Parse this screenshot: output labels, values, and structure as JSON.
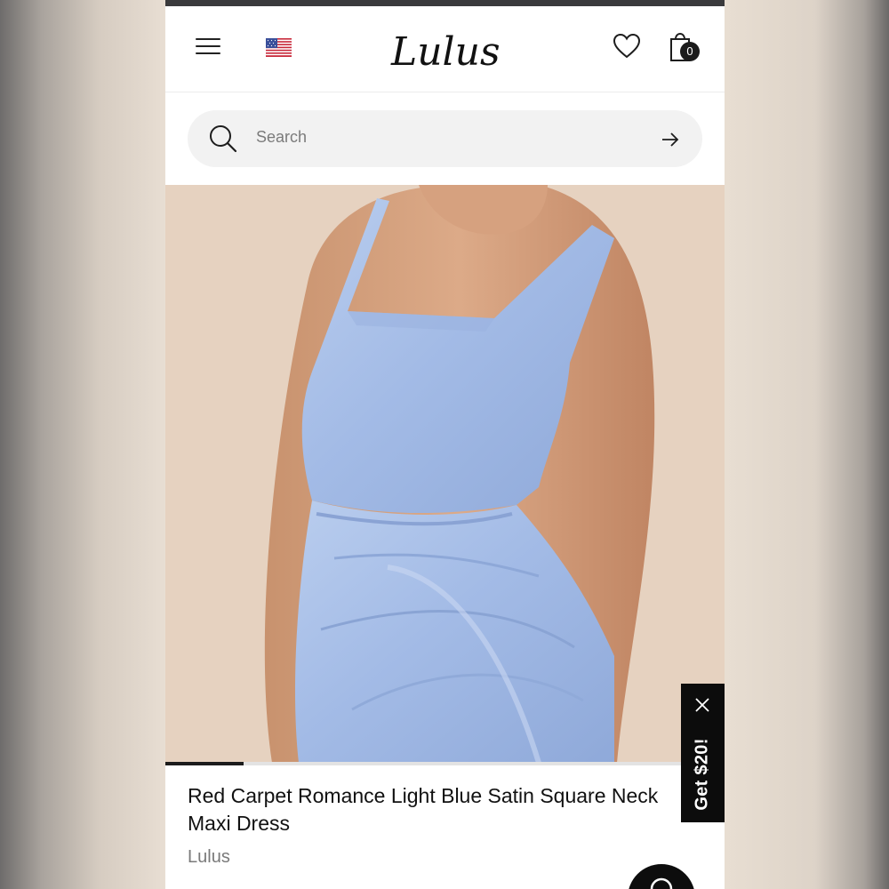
{
  "header": {
    "menu_icon": "hamburger-icon",
    "flag_icon": "us-flag-icon",
    "logo_text": "Lulus",
    "wishlist_icon": "heart-icon",
    "cart_icon": "shopping-bag-icon",
    "cart_count": "0"
  },
  "search": {
    "placeholder": "Search",
    "icon": "search-icon",
    "submit_icon": "arrow-right-icon"
  },
  "gallery": {
    "image": "light blue satin square neck dress product photo",
    "progress": 0.14
  },
  "product": {
    "title": "Red Carpet Romance Light Blue Satin Square Neck Maxi Dress",
    "brand": "Lulus"
  },
  "promo": {
    "label": "Get $20!",
    "close_icon": "close-icon"
  },
  "chat": {
    "icon": "chat-icon"
  },
  "colors": {
    "dress": "#a9c2e8",
    "backdrop": "#e6d2c0",
    "promo_bg": "#0c0c0c",
    "search_bg": "#f2f2f2"
  }
}
